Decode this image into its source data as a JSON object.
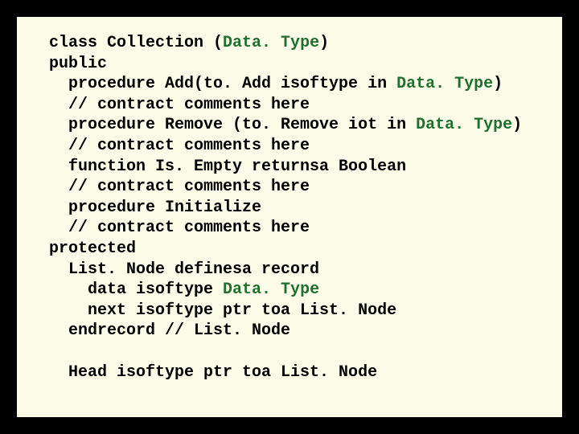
{
  "code": {
    "l1a": "class Collection (",
    "l1b": "Data. Type",
    "l1c": ")",
    "l2": "public",
    "l3a": "  procedure Add(to. Add isoftype in ",
    "l3b": "Data. Type",
    "l3c": ")",
    "l4": "  // contract comments here",
    "l5a": "  procedure Remove (to. Remove iot in ",
    "l5b": "Data. Type",
    "l5c": ")",
    "l6": "  // contract comments here",
    "l7": "  function Is. Empty returnsa Boolean",
    "l8": "  // contract comments here",
    "l9": "  procedure Initialize",
    "l10": "  // contract comments here",
    "l11": "protected",
    "l12": "  List. Node definesa record",
    "l13a": "    data isoftype ",
    "l13b": "Data. Type",
    "l14": "    next isoftype ptr toa List. Node",
    "l15": "  endrecord // List. Node",
    "blank": "",
    "l16": "  Head isoftype ptr toa List. Node"
  }
}
